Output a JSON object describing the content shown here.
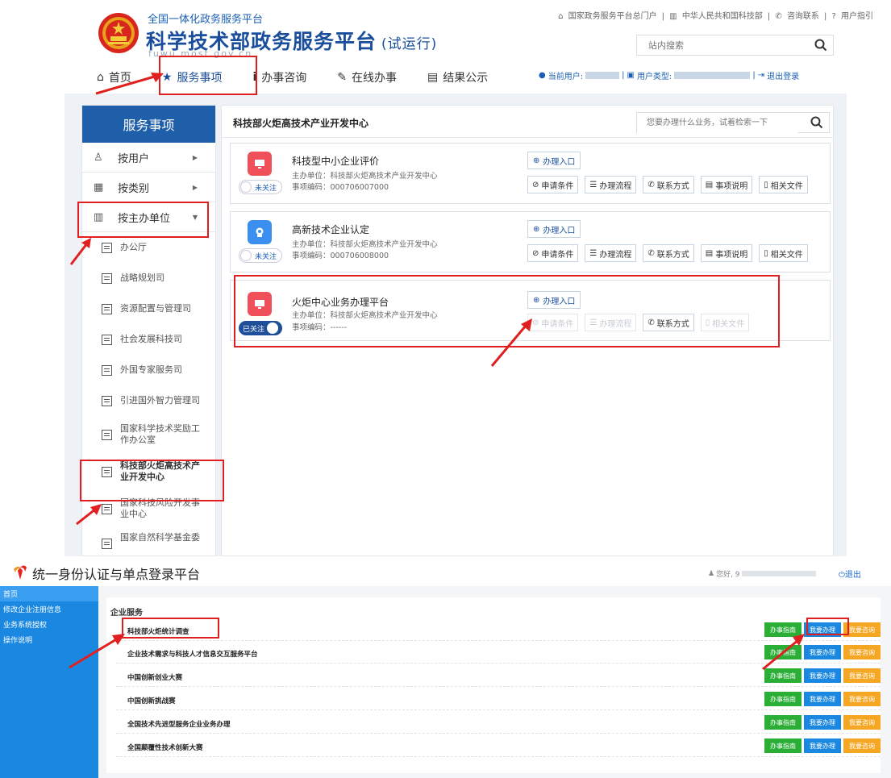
{
  "header": {
    "subtitle": "全国一体化政务服务平台",
    "title": "科学技术部政务服务平台",
    "trial": "(试运行)",
    "url": "fuwu.most.gov.cn",
    "top_links": [
      "国家政务服务平台总门户",
      "中华人民共和国科技部",
      "咨询联系",
      "用户指引"
    ],
    "search_placeholder": "站内搜索"
  },
  "nav": {
    "items": [
      {
        "label": "首页",
        "icon": "home-icon"
      },
      {
        "label": "服务事项",
        "icon": "star-icon"
      },
      {
        "label": "办事咨询",
        "icon": "info-icon"
      },
      {
        "label": "在线办事",
        "icon": "pencil-icon"
      },
      {
        "label": "结果公示",
        "icon": "book-icon"
      }
    ],
    "current_user_label": "当前用户:",
    "user_type_label": "用户类型:",
    "logout": "退出登录"
  },
  "sidebar": {
    "title": "服务事项",
    "categories": [
      {
        "label": "按用户"
      },
      {
        "label": "按类别"
      },
      {
        "label": "按主办单位"
      }
    ],
    "units": [
      "办公厅",
      "战略规划司",
      "资源配置与管理司",
      "社会发展科技司",
      "外国专家服务司",
      "引进国外智力管理司",
      "国家科学技术奖励工作办公室",
      "科技部火炬高技术产业开发中心",
      "国家科技风险开发事业中心",
      "国家自然科学基金委"
    ]
  },
  "panel": {
    "title": "科技部火炬高技术产业开发中心",
    "search_placeholder": "您要办理什么业务，试着检索一下",
    "services": [
      {
        "name": "科技型中小企业评价",
        "host": "主办单位：科技部火炬高技术产业开发中心",
        "code": "事项编码：000706007000",
        "follow": "未关注",
        "color": "#f0505a"
      },
      {
        "name": "高新技术企业认定",
        "host": "主办单位：科技部火炬高技术产业开发中心",
        "code": "事项编码：000706008000",
        "follow": "未关注",
        "color": "#3b8ff0"
      },
      {
        "name": "火炬中心业务办理平台",
        "host": "主办单位：科技部火炬高技术产业开发中心",
        "code": "事项编码：------",
        "follow": "已关注",
        "color": "#f0505a"
      }
    ],
    "enter_label": "办理入口",
    "actions": [
      "申请条件",
      "办理流程",
      "联系方式",
      "事项说明",
      "相关文件"
    ]
  },
  "sso": {
    "title": "统一身份认证与单点登录平台",
    "greeting": "您好, 9",
    "logout": "退出",
    "side": [
      "首页",
      "修改企业注册信息",
      "业务系统授权",
      "操作说明"
    ],
    "section": "企业服务",
    "rows": [
      "科技部火炬统计调查",
      "企业技术需求与科技人才信息交互服务平台",
      "中国创新创业大赛",
      "中国创新挑战赛",
      "全国技术先进型服务企业业务办理",
      "全国颠覆性技术创新大赛"
    ],
    "btn_guide": "办事指南",
    "btn_handle": "我要办理",
    "btn_consult": "我要咨询"
  },
  "colors": {
    "brand_blue": "#1f5faa",
    "annotation_red": "#e02020",
    "sso_blue": "#1a88e0"
  }
}
